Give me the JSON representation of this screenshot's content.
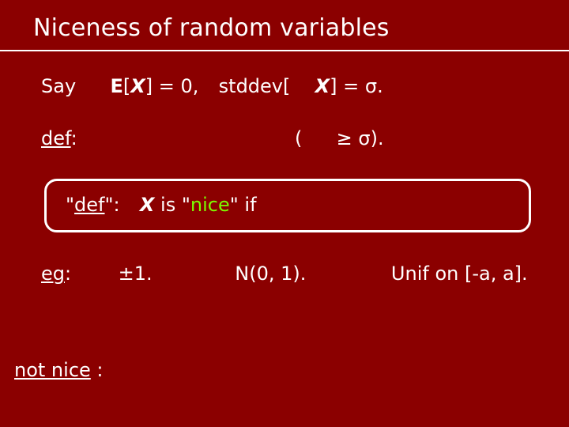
{
  "title": "Niceness of random variables",
  "line1": {
    "say": "Say",
    "ex": "E",
    "lb": "[",
    "X": "X",
    "eq0": "] = 0,",
    "stddev": "stddev[",
    "X2": "X",
    "eqsigma": "] = σ."
  },
  "line2": {
    "def": "def",
    "colon": ":",
    "paren": "(",
    "ge": "≥ σ)."
  },
  "box": {
    "q1": "\"",
    "def": "def",
    "q2": "\":",
    "X": "X",
    "is": " is \"",
    "nice": "nice",
    "end": "\" if"
  },
  "eg": {
    "eg": "eg",
    "colon": ":",
    "pm": "±1.",
    "n01": "N(0, 1).",
    "unif": "Unif on [-a, a]."
  },
  "notnice": {
    "label": "not nice",
    "colon": ":"
  }
}
